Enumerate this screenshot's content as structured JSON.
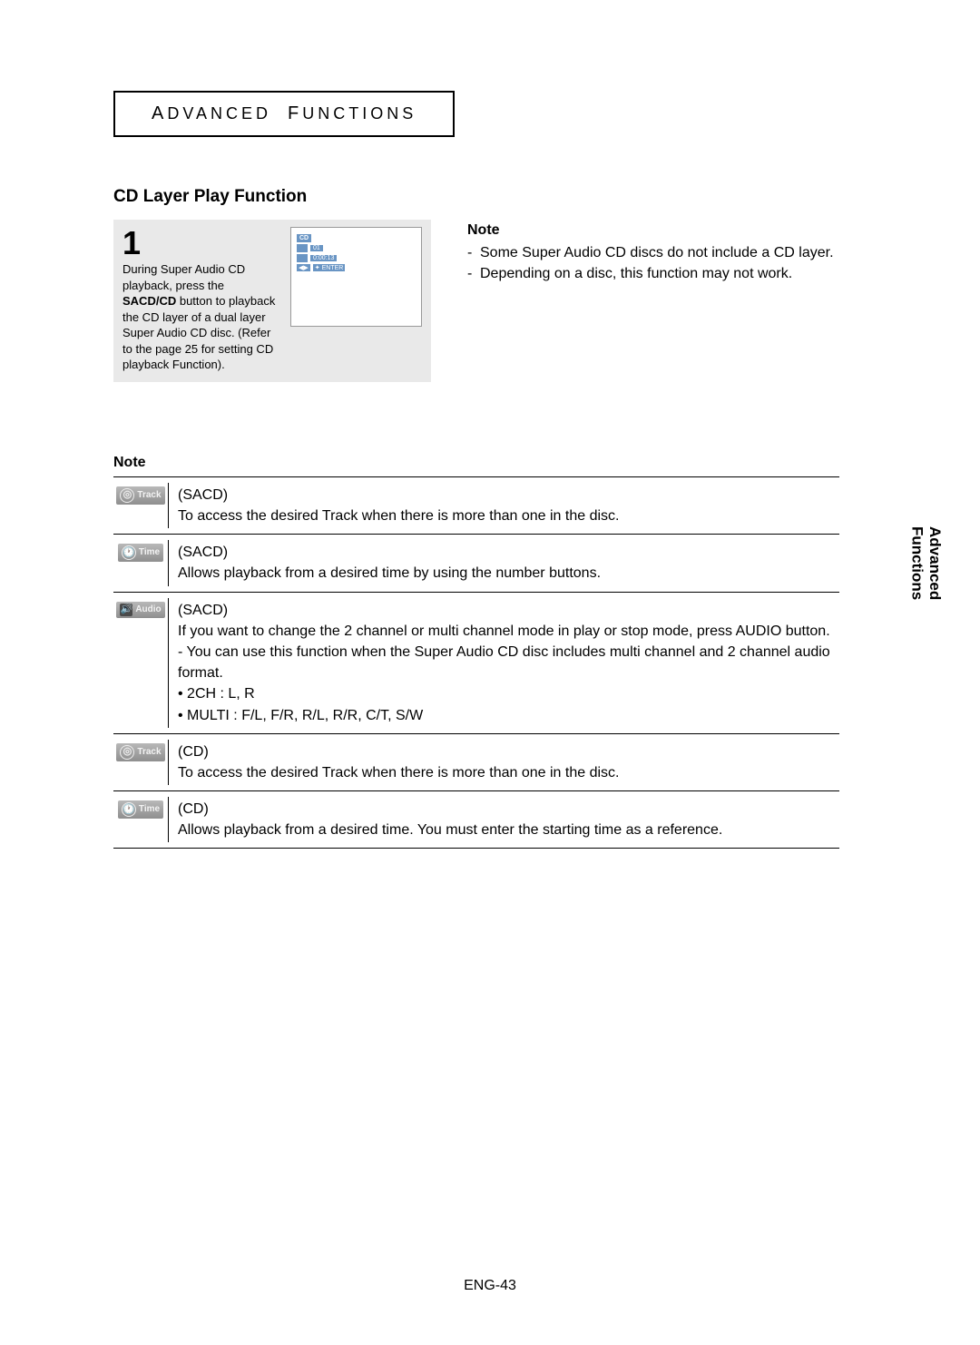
{
  "chapter": {
    "label_a": "A",
    "label_dvanced": "DVANCED",
    "label_f": "F",
    "label_unctions": "UNCTIONS"
  },
  "section_title": "CD Layer Play Function",
  "step": {
    "number": "1",
    "text_pre": "During Super Audio CD playback, press the ",
    "text_bold": "SACD/CD",
    "text_post": " button to playback the CD layer of a dual layer Super Audio CD disc. (Refer to the page 25 for setting CD playback Function)."
  },
  "screen": {
    "header": "CD",
    "track_val": "01",
    "time_val": "0:00:13",
    "bt1": "◀▶",
    "bt2": "✦ ENTER"
  },
  "right_note": {
    "heading": "Note",
    "items": [
      "Some Super Audio CD discs do not include a CD layer.",
      "Depending on a disc, this function may not work."
    ]
  },
  "note_heading": "Note",
  "note_rows": [
    {
      "icon_name": "track-icon",
      "icon_label": "Track",
      "icon_style": "circle",
      "icon_glyph": "◎",
      "type": "(SACD)",
      "lines": [
        "To access the desired Track when there is more than one in the disc."
      ]
    },
    {
      "icon_name": "time-icon",
      "icon_label": "Time",
      "icon_style": "circle",
      "icon_glyph": "🕐",
      "type": "(SACD)",
      "lines": [
        "Allows playback from a desired time by using the number buttons."
      ]
    },
    {
      "icon_name": "audio-icon",
      "icon_label": "Audio",
      "icon_style": "box",
      "icon_glyph": "🔊",
      "type": "(SACD)",
      "lines": [
        "If you want to change the 2 channel or multi channel mode in play or stop mode, press AUDIO button.",
        "- You can use this function when the Super Audio CD disc includes multi channel and 2 channel audio format.",
        "• 2CH : L, R",
        "• MULTI : F/L, F/R, R/L, R/R, C/T, S/W"
      ]
    },
    {
      "icon_name": "track-icon",
      "icon_label": "Track",
      "icon_style": "circle",
      "icon_glyph": "◎",
      "type": "(CD)",
      "lines": [
        "To access the desired Track when there is more than one in the disc."
      ]
    },
    {
      "icon_name": "time-icon",
      "icon_label": "Time",
      "icon_style": "circle",
      "icon_glyph": "🕐",
      "type": "(CD)",
      "lines": [
        "Allows playback from a desired time. You must enter the starting time as a reference."
      ]
    }
  ],
  "side_tab": {
    "line1": "Advanced",
    "line2": "Functions"
  },
  "page_number": "ENG-43"
}
